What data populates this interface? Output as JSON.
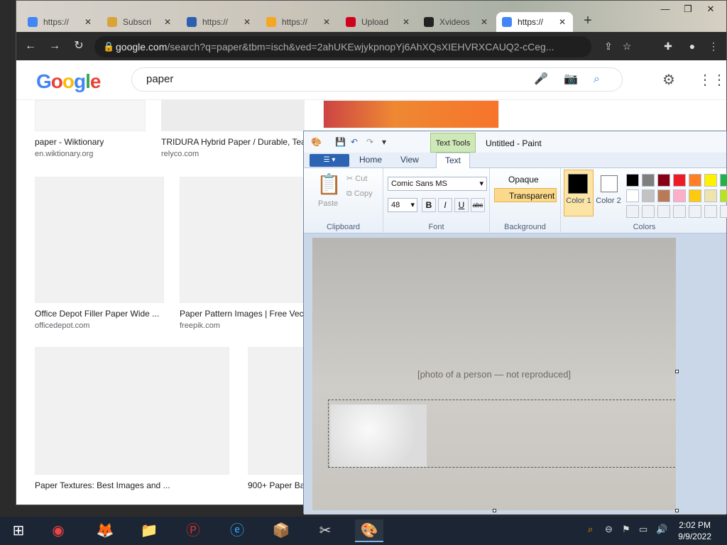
{
  "browser": {
    "tabs": [
      {
        "title": "https://",
        "favicon_color": "#4285f4"
      },
      {
        "title": "Subscri",
        "favicon_color": "#d8a43a"
      },
      {
        "title": "https://",
        "favicon_color": "#2d5fb0"
      },
      {
        "title": "https://",
        "favicon_color": "#f5a623"
      },
      {
        "title": "Upload",
        "favicon_color": "#d0021b"
      },
      {
        "title": "Xvideos",
        "favicon_color": "#222222"
      },
      {
        "title": "https://",
        "favicon_color": "#4285f4"
      }
    ],
    "url_host": "google.com",
    "url_rest": "/search?q=paper&tbm=isch&ved=2ahUKEwjykpnopYj6AhXQsXIEHVRXCAUQ2-cCeg..."
  },
  "google": {
    "logo": [
      "G",
      "o",
      "o",
      "g",
      "l",
      "e"
    ],
    "query": "paper",
    "results": [
      {
        "caption": "paper - Wiktionary",
        "source": "en.wiktionary.org"
      },
      {
        "caption": "TRIDURA Hybrid Paper / Durable, Tea",
        "source": "relyco.com"
      },
      {
        "caption": "Office Depot Filler Paper Wide ...",
        "source": "officedepot.com"
      },
      {
        "caption": "Paper Pattern Images | Free Vec",
        "source": "freepik.com"
      },
      {
        "caption": "Paper Textures: Best Images and ...",
        "source": ""
      },
      {
        "caption": "900+ Paper Ba",
        "source": ""
      }
    ]
  },
  "paint": {
    "title": "Untitled - Paint",
    "text_tools": "Text Tools",
    "tabs": [
      "Home",
      "View",
      "Text"
    ],
    "clipboard": {
      "label": "Clipboard",
      "paste": "Paste",
      "cut": "Cut",
      "copy": "Copy"
    },
    "font": {
      "label": "Font",
      "family": "Comic Sans MS",
      "size": "48",
      "bold": "B",
      "italic": "I",
      "underline": "U",
      "strike": "abc"
    },
    "background": {
      "label": "Background",
      "opaque": "Opaque",
      "transparent": "Transparent"
    },
    "colors": {
      "label": "Colors",
      "color1_label": "Color 1",
      "color2_label": "Color 2",
      "color1": "#000000",
      "color2": "#ffffff",
      "palette_row1": [
        "#000000",
        "#7f7f7f",
        "#880015",
        "#ed1c24",
        "#ff7f27",
        "#fff200",
        "#22b14c"
      ],
      "palette_row2": [
        "#ffffff",
        "#c3c3c3",
        "#b97a57",
        "#ffaec9",
        "#ffc90e",
        "#efe4b0",
        "#b5e61d"
      ]
    },
    "canvas_note": "[photo of a person — not reproduced]"
  },
  "taskbar": {
    "time": "2:02 PM",
    "date": "9/9/2022"
  }
}
